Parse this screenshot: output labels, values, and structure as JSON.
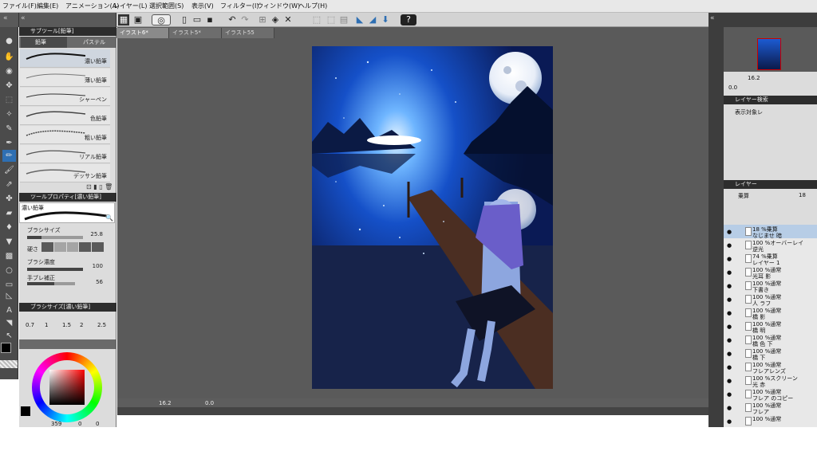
{
  "menu": [
    "ファイル(F)",
    "編集(E)",
    "アニメーション(A)",
    "レイヤー(L)",
    "選択範囲(S)",
    "表示(V)",
    "フィルター(I)",
    "ウィンドウ(W)",
    "ヘルプ(H)"
  ],
  "tabs": [
    "イラスト6*",
    "イラスト5*",
    "イラスト55"
  ],
  "subtool": {
    "header": "サブツール[鉛筆]",
    "tab_pencil": "鉛筆",
    "tab_pastel": "パステル",
    "brushes": [
      "濃い鉛筆",
      "薄い鉛筆",
      "シャーペン",
      "色鉛筆",
      "粗い鉛筆",
      "リアル鉛筆",
      "デッサン鉛筆"
    ]
  },
  "toolprop": {
    "header": "ツールプロパティ[濃い鉛筆]",
    "preview_label": "濃い鉛筆",
    "brush_size_label": "ブラシサイズ",
    "brush_size_value": "25.8",
    "brush_size_fraction": 0.26,
    "hardness_label": "硬さ",
    "density_label": "ブラシ濃度",
    "density_value": "100",
    "density_fraction": 1.0,
    "stabilize_label": "手ブレ補正",
    "stabilize_value": "56",
    "stabilize_fraction": 0.56
  },
  "brushsize": {
    "header": "ブラシサイズ[濃い鉛筆]",
    "sizes": [
      "0.7",
      "1",
      "1.5",
      "2",
      "2.5"
    ]
  },
  "color": {
    "main": "#000000",
    "sub": "#ffffff",
    "hue_box": "#ff0000",
    "bottom_value": "359",
    "bottom_s": "0",
    "bottom_v": "0"
  },
  "canvas_status": {
    "zoom": "16.2",
    "angle": "0.0"
  },
  "navigator": {
    "zoom": "16.2",
    "angle": "0.0"
  },
  "layer_search": "レイヤー検索",
  "layer_search_scope": "表示対象レ",
  "layer_panel": {
    "header": "レイヤー",
    "blend_mode": "乗算",
    "opacity": "18"
  },
  "layers": [
    {
      "line1": "18 %乗算",
      "line2": "なじませ 暗",
      "selected": true
    },
    {
      "line1": "100 %オーバーレイ",
      "line2": "逆光",
      "selected": false
    },
    {
      "line1": "74 %乗算",
      "line2": "レイヤー 1",
      "selected": false
    },
    {
      "line1": "100 %通常",
      "line2": "光耳 影",
      "selected": false
    },
    {
      "line1": "100 %通常",
      "line2": "下書き",
      "selected": false
    },
    {
      "line1": "100 %通常",
      "line2": "人 ラフ",
      "selected": false
    },
    {
      "line1": "100 %通常",
      "line2": "橋 影",
      "selected": false
    },
    {
      "line1": "100 %通常",
      "line2": "橋 明",
      "selected": false
    },
    {
      "line1": "100 %通常",
      "line2": "橋 色 下",
      "selected": false
    },
    {
      "line1": "100 %通常",
      "line2": "橋 下",
      "selected": false
    },
    {
      "line1": "100 %通常",
      "line2": "フレアレンズ",
      "selected": false
    },
    {
      "line1": "100 %スクリーン",
      "line2": "光 赤",
      "selected": false
    },
    {
      "line1": "100 %通常",
      "line2": "フレア のコピー",
      "selected": false
    },
    {
      "line1": "100 %通常",
      "line2": "フレア",
      "selected": false
    },
    {
      "line1": "100 %通常",
      "line2": "",
      "selected": false
    }
  ]
}
